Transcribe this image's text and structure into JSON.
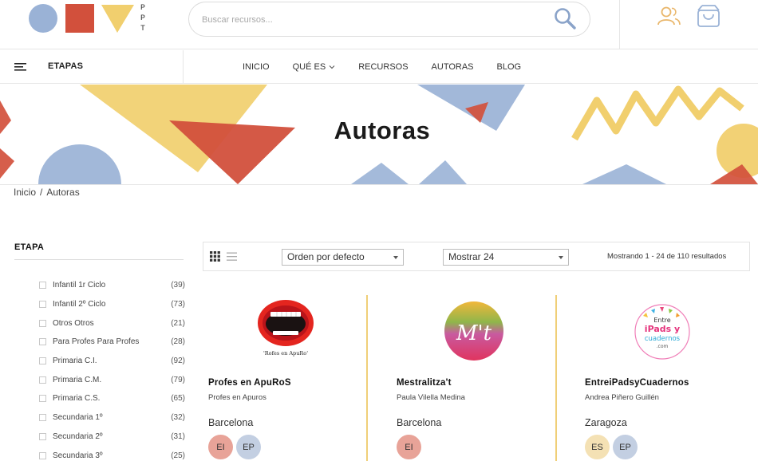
{
  "header": {
    "logo_letters": [
      "P",
      "P",
      "T"
    ],
    "search": {
      "placeholder": "Buscar recursos...",
      "value": ""
    },
    "icons": [
      "search-icon",
      "user-icon",
      "shopping-bag-icon"
    ],
    "colors": {
      "blue": "#9ab2d6",
      "red": "#d2503c",
      "yellow": "#f1cf6e",
      "accent": "#f0cf78"
    }
  },
  "nav": {
    "etapas_label": "ETAPAS",
    "links": [
      {
        "label": "INICIO",
        "has_dropdown": false
      },
      {
        "label": "QUÉ ES",
        "has_dropdown": true
      },
      {
        "label": "RECURSOS",
        "has_dropdown": false
      },
      {
        "label": "AUTORAS",
        "has_dropdown": false
      },
      {
        "label": "BLOG",
        "has_dropdown": false
      }
    ]
  },
  "hero": {
    "title": "Autoras"
  },
  "breadcrumb": {
    "home": "Inicio",
    "separator": "/",
    "current": "Autoras"
  },
  "filter": {
    "title": "ETAPA",
    "items": [
      {
        "label": "Infantil 1r Ciclo",
        "count": "(39)"
      },
      {
        "label": "Infantil 2º Ciclo",
        "count": "(73)"
      },
      {
        "label": "Otros Otros",
        "count": "(21)"
      },
      {
        "label": "Para Profes Para Profes",
        "count": "(28)"
      },
      {
        "label": "Primaria C.I.",
        "count": "(92)"
      },
      {
        "label": "Primaria C.M.",
        "count": "(79)"
      },
      {
        "label": "Primaria C.S.",
        "count": "(65)"
      },
      {
        "label": "Secundaria 1º",
        "count": "(32)"
      },
      {
        "label": "Secundaria 2º",
        "count": "(31)"
      },
      {
        "label": "Secundaria 3º",
        "count": "(25)"
      }
    ]
  },
  "toolbar": {
    "order_selected": "Orden por defecto",
    "show_selected": "Mostrar 24",
    "result_text": "Mostrando 1 - 24 de 110 resultados"
  },
  "authors": [
    {
      "name": "Profes en ApuRoS",
      "person": "Profes en Apuros",
      "city": "Barcelona",
      "tags": [
        "EI",
        "EP"
      ],
      "logo_caption": "'Rofes en ApuRo'"
    },
    {
      "name": "Mestralitza't",
      "person": "Paula Vilella Medina",
      "city": "Barcelona",
      "tags": [
        "EI"
      ],
      "logo_text": "M't"
    },
    {
      "name": "EntreiPadsyCuadernos",
      "person": "Andrea Piñero Guillén",
      "city": "Zaragoza",
      "tags": [
        "ES",
        "EP"
      ],
      "logo_lines": [
        "Entre",
        "iPads y",
        "cuadernos",
        ".com"
      ]
    }
  ]
}
